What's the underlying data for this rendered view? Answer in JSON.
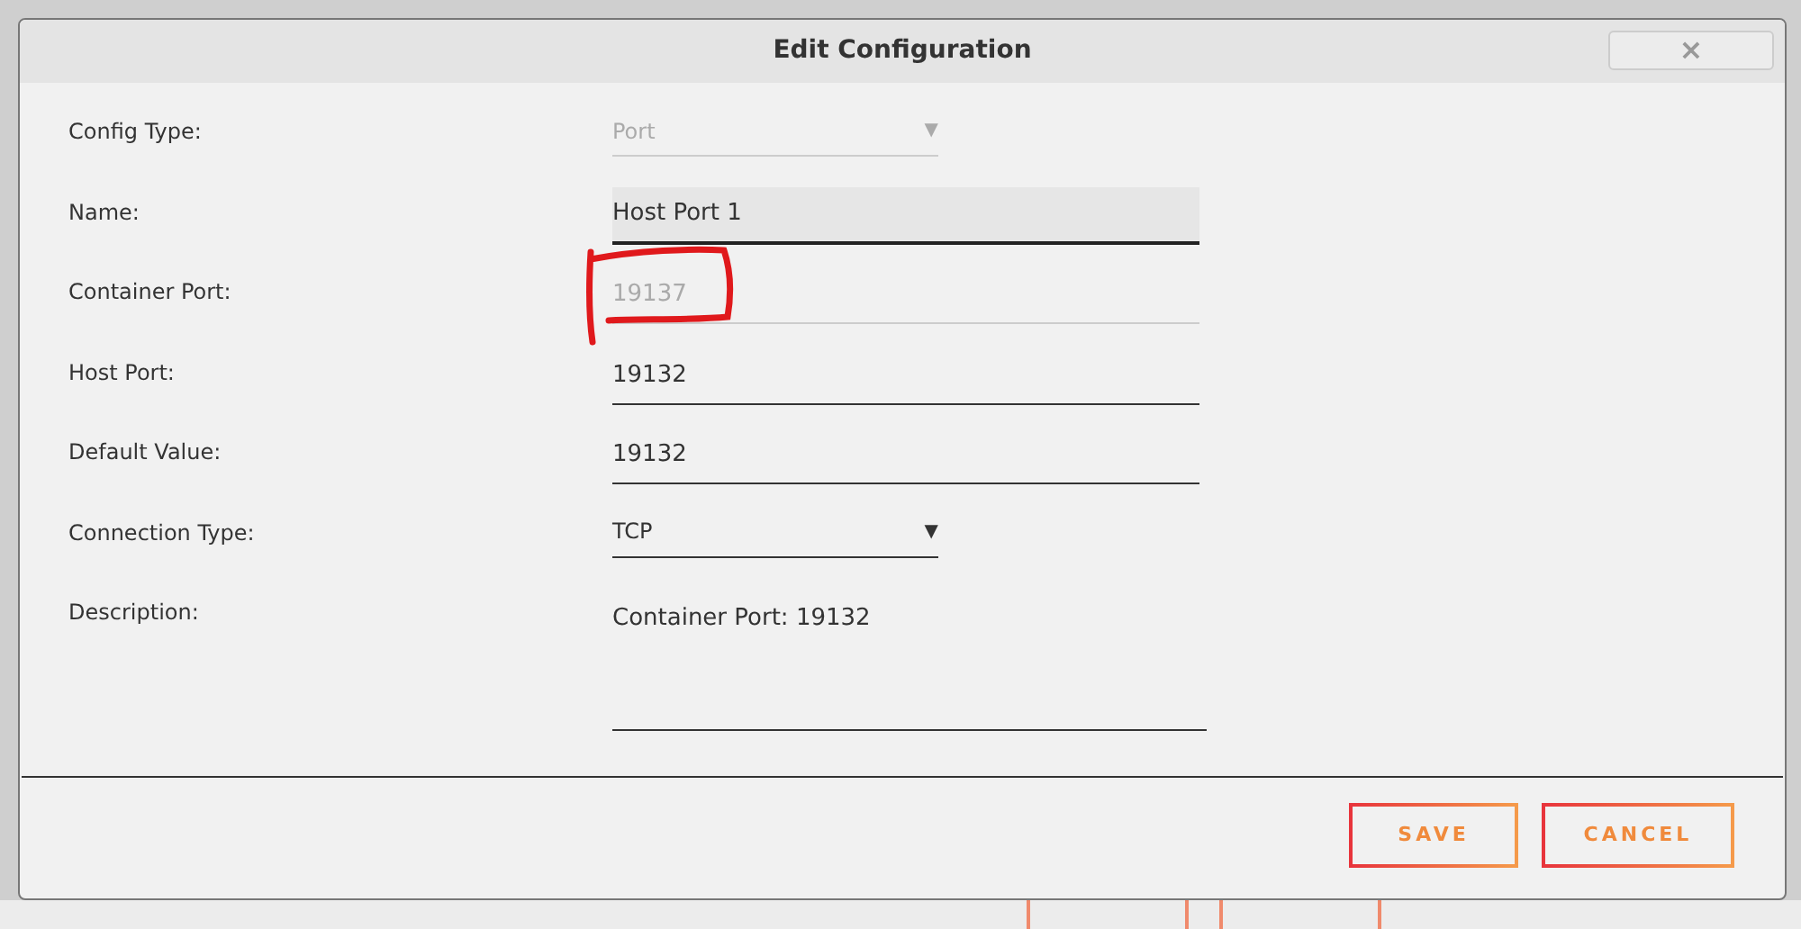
{
  "dialog": {
    "title": "Edit Configuration",
    "close_label": "×"
  },
  "fields": [
    {
      "label": "Config Type:",
      "kind": "select",
      "value": "Port",
      "caret": "▼",
      "disabled": true
    },
    {
      "label": "Name:",
      "kind": "input",
      "value": "Host Port 1",
      "disabled": false,
      "focused": true
    },
    {
      "label": "Container Port:",
      "kind": "input",
      "value": "19137",
      "disabled": true,
      "annotated": true
    },
    {
      "label": "Host Port:",
      "kind": "input",
      "value": "19132",
      "disabled": false
    },
    {
      "label": "Default Value:",
      "kind": "input",
      "value": "19132",
      "disabled": false
    },
    {
      "label": "Connection Type:",
      "kind": "select",
      "value": "TCP",
      "caret": "▼",
      "disabled": false
    },
    {
      "label": "Description:",
      "kind": "textarea",
      "value": "Container Port: 19132",
      "disabled": false
    }
  ],
  "buttons": [
    {
      "label": "SAVE"
    },
    {
      "label": "CANCEL"
    }
  ]
}
